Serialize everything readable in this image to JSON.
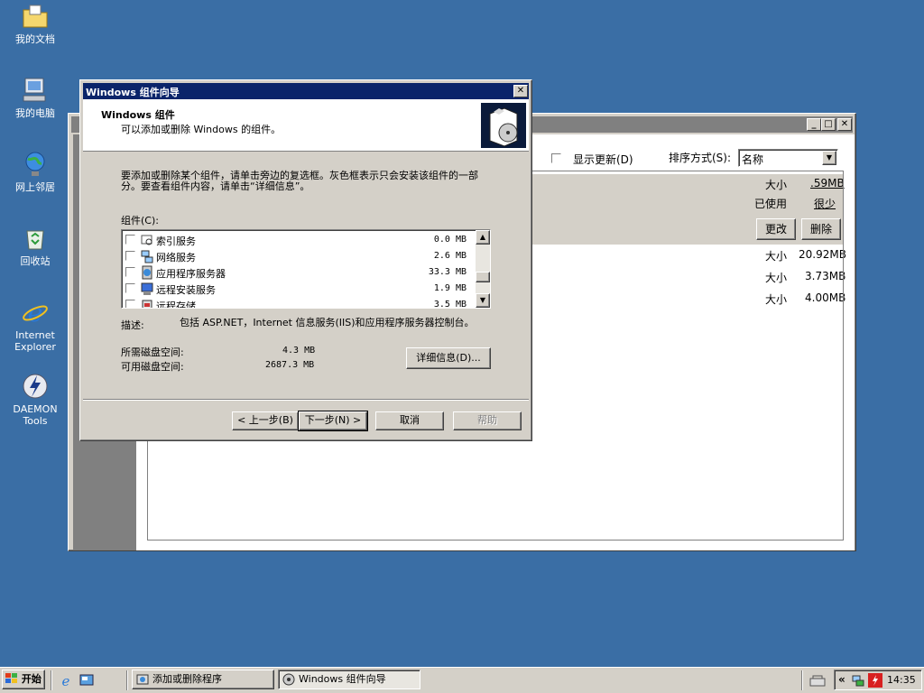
{
  "desktop": {
    "icons": [
      {
        "label": "我的文档"
      },
      {
        "label": "我的电脑"
      },
      {
        "label": "网上邻居"
      },
      {
        "label": "回收站"
      },
      {
        "label": "Internet Explorer"
      },
      {
        "label": "DAEMON Tools"
      }
    ]
  },
  "bg_window": {
    "show_updates_label": "显示更新(D)",
    "sort_label": "排序方式(S):",
    "sort_value": "名称",
    "size_label": "大小",
    "size_value": ".59MB",
    "used_label": "已使用",
    "used_value": "很少",
    "change_button": "更改",
    "remove_button": "删除",
    "rows": [
      {
        "label": "大小",
        "value": "20.92MB"
      },
      {
        "label": "大小",
        "value": "3.73MB"
      },
      {
        "label": "大小",
        "value": "4.00MB"
      }
    ]
  },
  "wizard": {
    "title": "Windows 组件向导",
    "header_title": "Windows 组件",
    "header_subtitle": "可以添加或删除 Windows 的组件。",
    "instructions": "要添加或删除某个组件，请单击旁边的复选框。灰色框表示只会安装该组件的一部分。要查看组件内容，请单击“详细信息”。",
    "components_label": "组件(C):",
    "components": [
      {
        "name": "索引服务",
        "size": "0.0 MB"
      },
      {
        "name": "网络服务",
        "size": "2.6 MB"
      },
      {
        "name": "应用程序服务器",
        "size": "33.3 MB"
      },
      {
        "name": "远程安装服务",
        "size": "1.9 MB"
      },
      {
        "name": "远程存储",
        "size": "3.5 MB"
      }
    ],
    "description_label": "描述:",
    "description": "包括 ASP.NET，Internet 信息服务(IIS)和应用程序服务器控制台。",
    "required_label": "所需磁盘空间:",
    "required_value": "4.3 MB",
    "available_label": "可用磁盘空间:",
    "available_value": "2687.3 MB",
    "details_button": "详细信息(D)...",
    "back_button": "< 上一步(B)",
    "next_button": "下一步(N) >",
    "cancel_button": "取消",
    "help_button": "帮助"
  },
  "taskbar": {
    "start_label": "开始",
    "tasks": [
      {
        "label": "添加或删除程序"
      },
      {
        "label": "Windows 组件向导"
      }
    ],
    "time": "14:35",
    "chevron": "«"
  },
  "colors": {
    "desktop": "#3a6ea5",
    "titlebar_active": "#0a246a",
    "titlebar_inactive": "#808080",
    "face": "#d4d0c8"
  }
}
